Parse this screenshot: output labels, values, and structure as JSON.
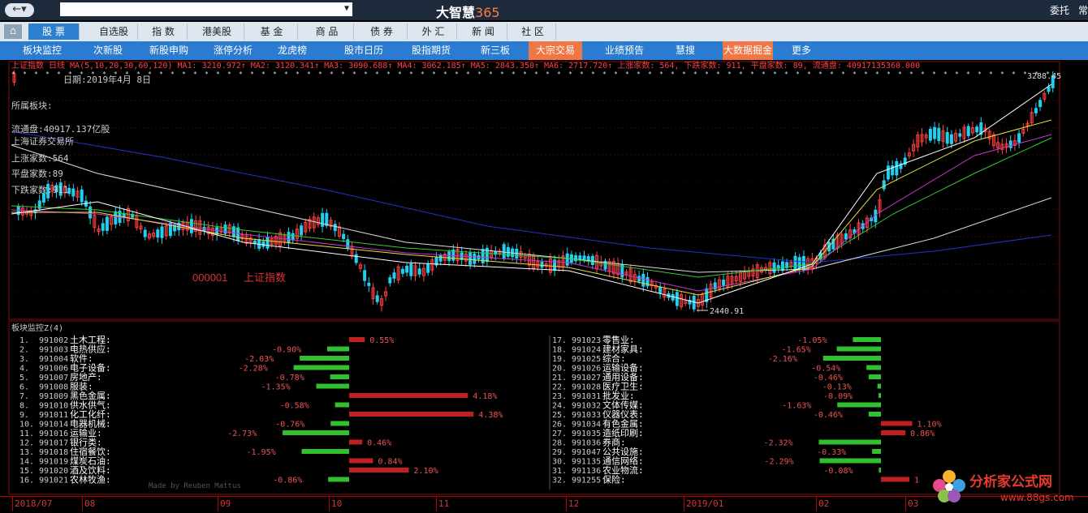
{
  "topbar": {
    "brand": "大智慧",
    "brand_num": "365",
    "right_label": "委托",
    "right_label2": "常"
  },
  "menu": [
    "股 票",
    "自选股",
    "指 数",
    "港美股",
    "基 金",
    "商 品",
    "债 券",
    "外 汇",
    "新 闻",
    "社 区"
  ],
  "submenu": [
    "板块监控",
    "次新股",
    "新股申购",
    "涨停分析",
    "龙虎榜",
    "股市日历",
    "股指期货",
    "新三板",
    "大宗交易",
    "业绩预告",
    "慧搜",
    "大数据掘金",
    "更多"
  ],
  "chart": {
    "header": "上证指数 日线  MA(5,10,20,30,60,120) MA1: 3210.972↑ MA2: 3120.341↑ MA3: 3090.688↑ MA4: 3062.185↑ MA5: 2843.350↑ MA6: 2717.720↑ 上涨家数: 564, 下跌家数: 911, 平盘家数: 89, 流通盘: 40917135360.000",
    "date_label": "日期:2019年4月 8日",
    "info": [
      "所属板块:",
      "流通盘:40917.137亿股",
      "上海证券交易所",
      "上涨家数:564",
      "平盘家数:89",
      "下跌家数:911"
    ],
    "code": "000001",
    "name": "上证指数",
    "high_label": "3288.45",
    "low_label": "2440.91",
    "panel_title": "板块监控Z(4)",
    "made_by": "Made by Reuben Mattus",
    "x_ticks": [
      "2018/07",
      "08",
      "09",
      "10",
      "11",
      "12",
      "2019/01",
      "02",
      "03"
    ]
  },
  "chart_data": {
    "type": "bar",
    "title": "板块监控Z(4)",
    "left": [
      {
        "no": "1.",
        "code": "991002",
        "name": "土木工程",
        "value": 0.55
      },
      {
        "no": "2.",
        "code": "991003",
        "name": "电热供应",
        "value": -0.9
      },
      {
        "no": "3.",
        "code": "991004",
        "name": "软件",
        "value": -2.03
      },
      {
        "no": "4.",
        "code": "991006",
        "name": "电子设备",
        "value": -2.28
      },
      {
        "no": "5.",
        "code": "991007",
        "name": "房地产",
        "value": -0.78
      },
      {
        "no": "6.",
        "code": "991008",
        "name": "服装",
        "value": -1.35
      },
      {
        "no": "7.",
        "code": "991009",
        "name": "黑色金属",
        "value": 4.18
      },
      {
        "no": "8.",
        "code": "991010",
        "name": "供水供气",
        "value": -0.58
      },
      {
        "no": "9.",
        "code": "991011",
        "name": "化工化纤",
        "value": 4.38
      },
      {
        "no": "10.",
        "code": "991014",
        "name": "电器机械",
        "value": -0.76
      },
      {
        "no": "11.",
        "code": "991016",
        "name": "运输业",
        "value": -2.73
      },
      {
        "no": "12.",
        "code": "991017",
        "name": "银行类",
        "value": 0.46
      },
      {
        "no": "13.",
        "code": "991018",
        "name": "住宿餐饮",
        "value": -1.95
      },
      {
        "no": "14.",
        "code": "991019",
        "name": "煤炭石油",
        "value": 0.84
      },
      {
        "no": "15.",
        "code": "991020",
        "name": "酒及饮料",
        "value": 2.1
      },
      {
        "no": "16.",
        "code": "991021",
        "name": "农林牧渔",
        "value": -0.86
      }
    ],
    "right": [
      {
        "no": "17.",
        "code": "991023",
        "name": "零售业",
        "value": -1.05
      },
      {
        "no": "18.",
        "code": "991024",
        "name": "建材家具",
        "value": -1.65
      },
      {
        "no": "19.",
        "code": "991025",
        "name": "综合",
        "value": -2.16
      },
      {
        "no": "20.",
        "code": "991026",
        "name": "运输设备",
        "value": -0.54
      },
      {
        "no": "21.",
        "code": "991027",
        "name": "通用设备",
        "value": -0.46
      },
      {
        "no": "22.",
        "code": "991028",
        "name": "医疗卫生",
        "value": -0.13
      },
      {
        "no": "23.",
        "code": "991031",
        "name": "批发业",
        "value": -0.09
      },
      {
        "no": "24.",
        "code": "991032",
        "name": "文体传媒",
        "value": -1.63
      },
      {
        "no": "25.",
        "code": "991033",
        "name": "仪器仪表",
        "value": -0.46
      },
      {
        "no": "26.",
        "code": "991034",
        "name": "有色金属",
        "value": 1.1
      },
      {
        "no": "27.",
        "code": "991035",
        "name": "造纸印刷",
        "value": 0.86
      },
      {
        "no": "28.",
        "code": "991036",
        "name": "券商",
        "value": -2.32
      },
      {
        "no": "29.",
        "code": "991047",
        "name": "公共设施",
        "value": -0.33
      },
      {
        "no": "30.",
        "code": "991135",
        "name": "通信网络",
        "value": -2.29
      },
      {
        "no": "31.",
        "code": "991136",
        "name": "农业物流",
        "value": -0.08
      },
      {
        "no": "32.",
        "code": "991255",
        "name": "保险",
        "value": 1.0,
        "label": "1"
      }
    ]
  },
  "colors": {
    "up": "#ff4040",
    "down": "#20d0f0",
    "pos_bar": "#c02020",
    "neg_bar": "#30c030"
  },
  "watermark": {
    "text": "分析家公式网",
    "url": "www.88gs.com"
  }
}
